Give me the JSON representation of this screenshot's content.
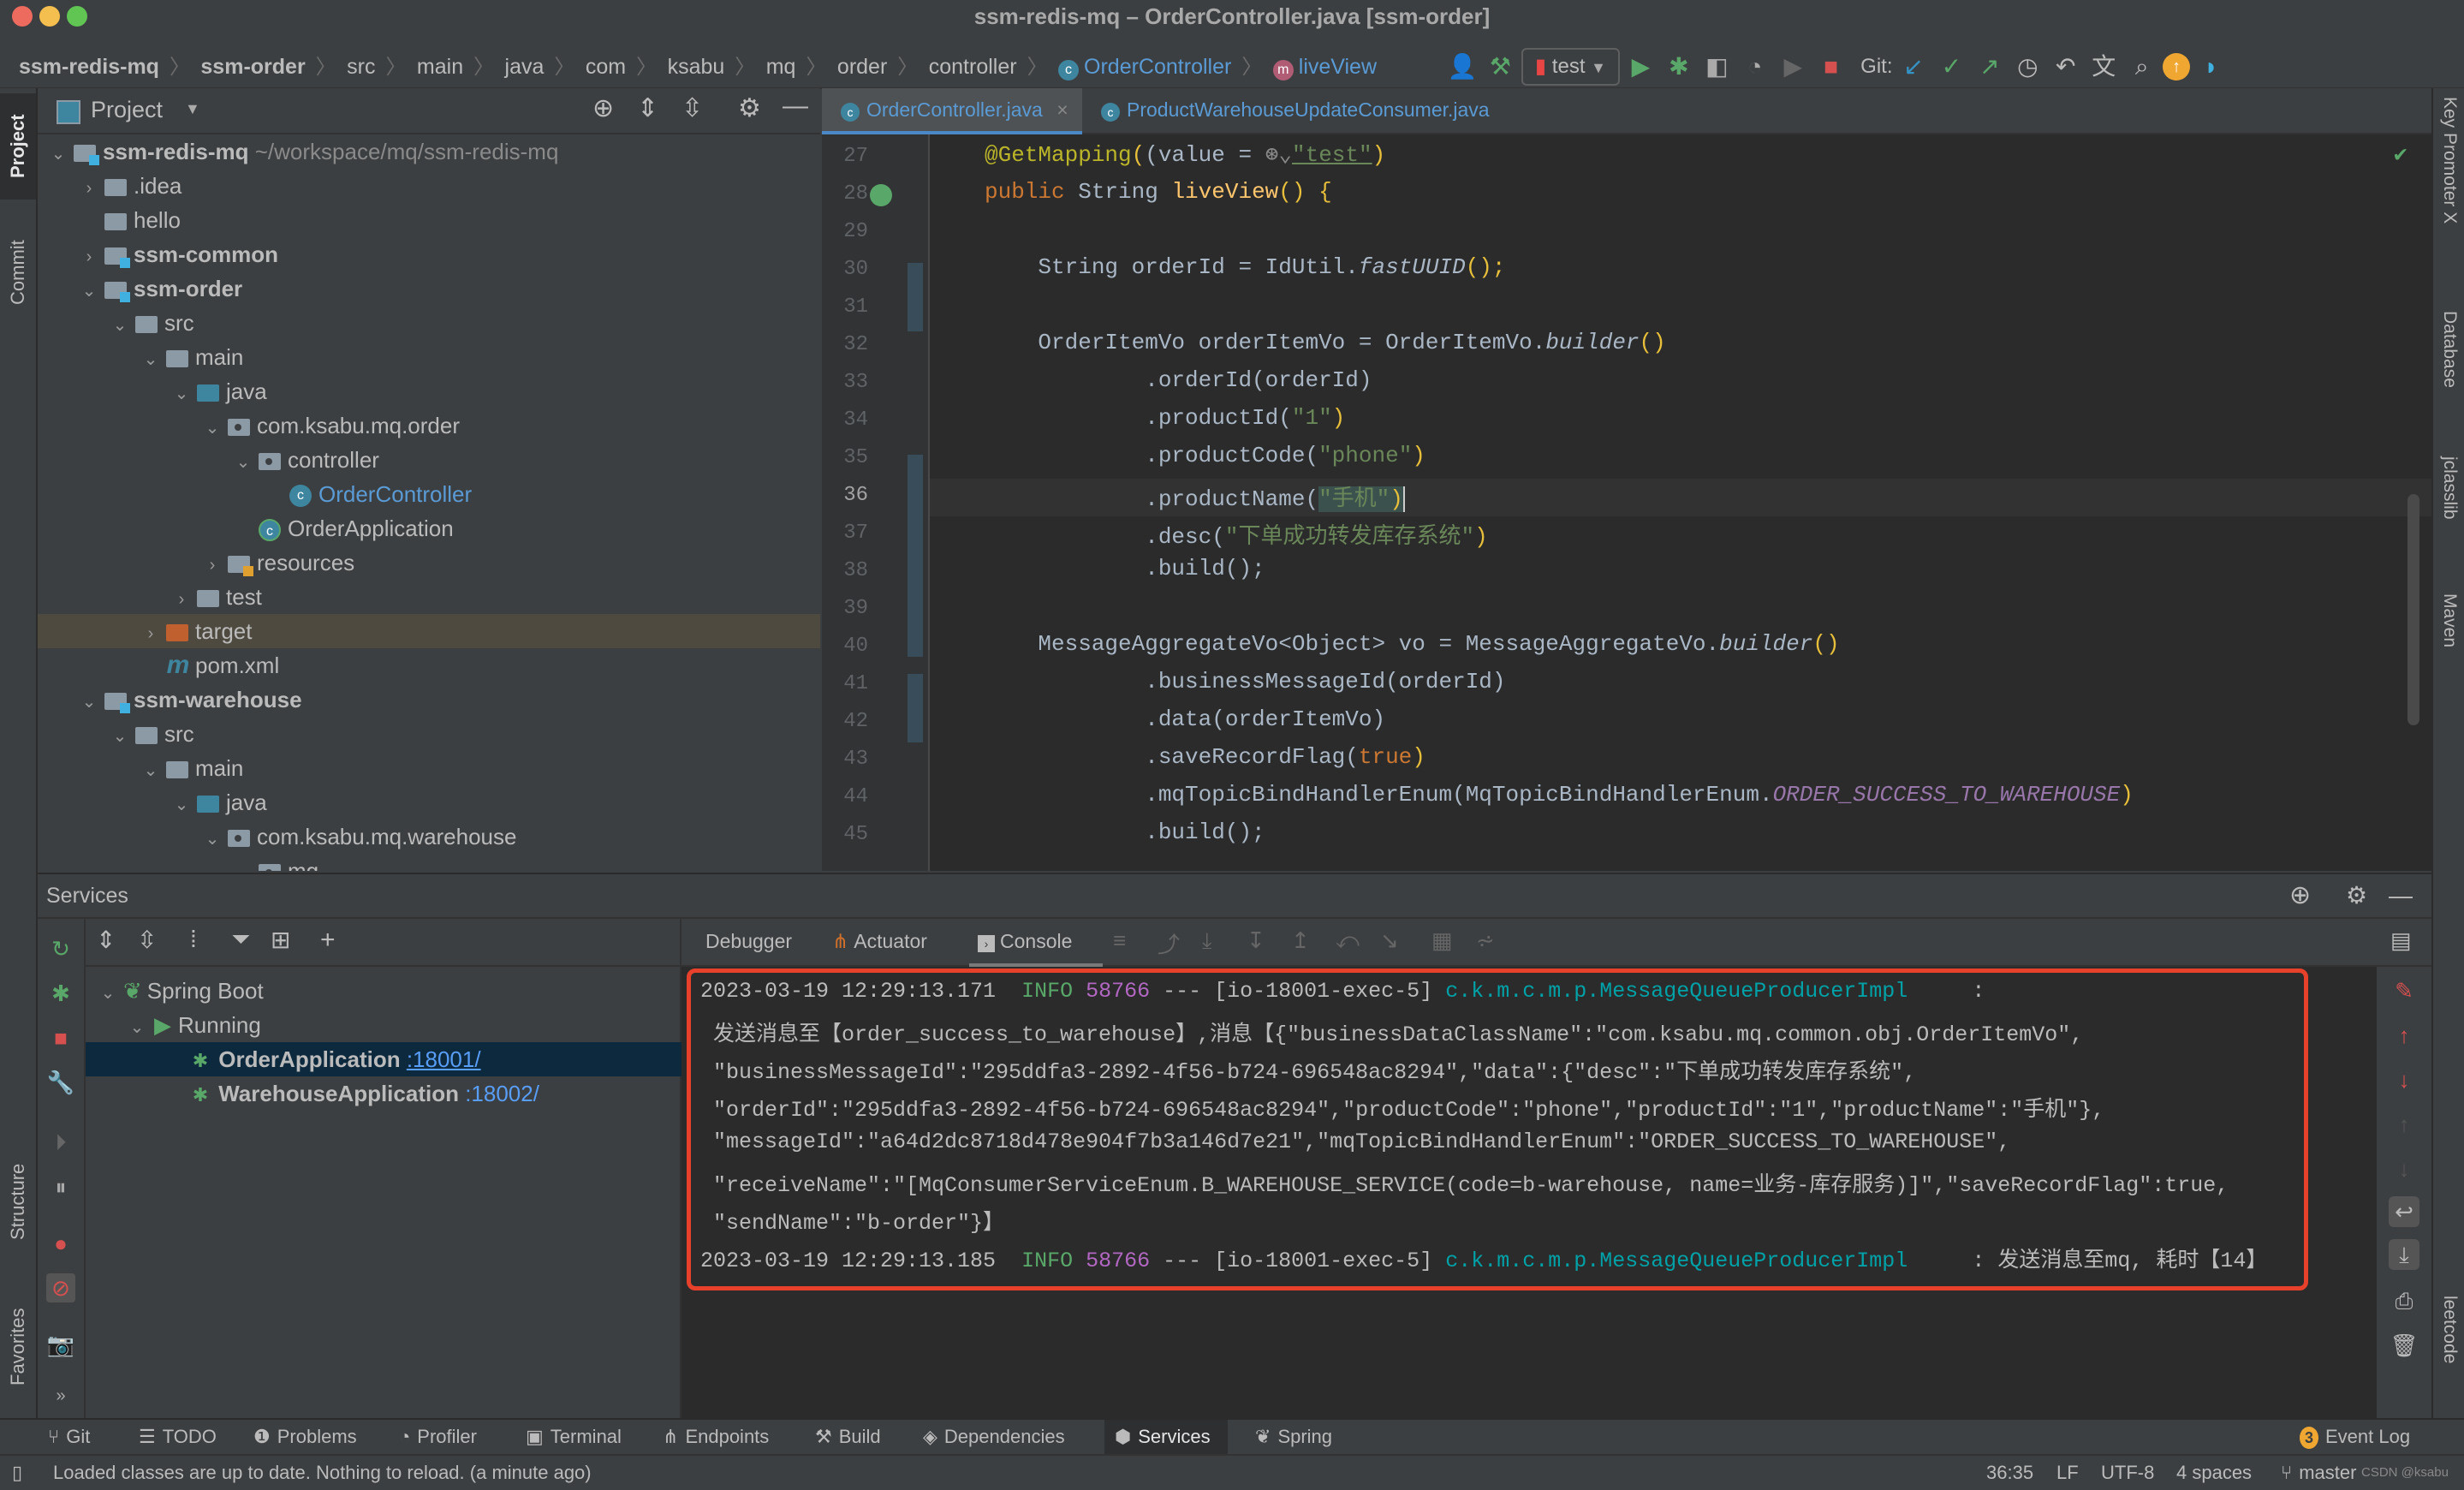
{
  "window": {
    "title": "ssm-redis-mq – OrderController.java [ssm-order]"
  },
  "breadcrumb": [
    "ssm-redis-mq",
    "ssm-order",
    "src",
    "main",
    "java",
    "com",
    "ksabu",
    "mq",
    "order",
    "controller",
    "OrderController",
    "liveView"
  ],
  "toolbar": {
    "run_config": "test",
    "git_label": "Git:"
  },
  "left_strip": {
    "project": "Project",
    "commit": "Commit",
    "structure": "Structure",
    "favorites": "Favorites"
  },
  "right_strip": {
    "key_promoter": "Key Promoter X",
    "database": "Database",
    "jclasslib": "jclasslib",
    "maven": "Maven",
    "leetcode": "leetcode"
  },
  "project": {
    "title": "Project",
    "tree": [
      {
        "label": "ssm-redis-mq",
        "extra": "~/workspace/mq/ssm-redis-mq",
        "bold": true
      },
      {
        "label": ".idea"
      },
      {
        "label": "hello"
      },
      {
        "label": "ssm-common",
        "bold": true
      },
      {
        "label": "ssm-order",
        "bold": true
      },
      {
        "label": "src"
      },
      {
        "label": "main"
      },
      {
        "label": "java"
      },
      {
        "label": "com.ksabu.mq.order"
      },
      {
        "label": "controller"
      },
      {
        "label": "OrderController"
      },
      {
        "label": "OrderApplication"
      },
      {
        "label": "resources"
      },
      {
        "label": "test"
      },
      {
        "label": "target"
      },
      {
        "label": "pom.xml"
      },
      {
        "label": "ssm-warehouse",
        "bold": true
      },
      {
        "label": "src"
      },
      {
        "label": "main"
      },
      {
        "label": "java"
      },
      {
        "label": "com.ksabu.mq.warehouse"
      },
      {
        "label": "mq"
      }
    ]
  },
  "editor": {
    "tabs": [
      {
        "label": "OrderController.java",
        "active": true
      },
      {
        "label": "ProductWarehouseUpdateConsumer.java",
        "active": false
      }
    ],
    "line_numbers": [
      "27",
      "28",
      "29",
      "30",
      "31",
      "32",
      "33",
      "34",
      "35",
      "36",
      "37",
      "38",
      "39",
      "40",
      "41",
      "42",
      "43",
      "44",
      "45"
    ],
    "code": {
      "l27_anno": "@GetMapping",
      "l27_rest": "(value = ",
      "l27_str": "\"test\"",
      "l28_kw": "public",
      "l28_type": " String ",
      "l28_fn": "liveView",
      "l28_rest": "() {",
      "l30_a": "    String orderId = IdUtil.",
      "l30_it": "fastUUID",
      "l30_b": "();",
      "l32_a": "    OrderItemVo orderItemVo = OrderItemVo.",
      "l32_it": "builder",
      "l32_b": "()",
      "l33": "            .orderId(orderId)",
      "l34_a": "            .productId(",
      "l34_s": "\"1\"",
      "l34_b": ")",
      "l35_a": "            .productCode(",
      "l35_s": "\"phone\"",
      "l35_b": ")",
      "l36_a": "            .productName(",
      "l36_s": "\"手机\"",
      "l36_b": ")",
      "l37_a": "            .desc(",
      "l37_s": "\"下单成功转发库存系统\"",
      "l37_b": ")",
      "l38": "            .build();",
      "l40_a": "    MessageAggregateVo<Object> vo = MessageAggregateVo.",
      "l40_it": "builder",
      "l40_b": "()",
      "l41": "            .businessMessageId(orderId)",
      "l42": "            .data(orderItemVo)",
      "l43_a": "            .saveRecordFlag(",
      "l43_kw": "true",
      "l43_b": ")",
      "l44_a": "            .mqTopicBindHandlerEnum(MqTopicBindHandlerEnum.",
      "l44_p": "ORDER_SUCCESS_TO_WAREHOUSE",
      "l44_b": ")",
      "l45": "            .build();"
    }
  },
  "services": {
    "title": "Services",
    "tree": {
      "root": "Spring Boot",
      "group": "Running",
      "apps": [
        {
          "name": "OrderApplication",
          "port": ":18001/",
          "selected": true
        },
        {
          "name": "WarehouseApplication",
          "port": ":18002/",
          "selected": false
        }
      ]
    },
    "tabs": [
      {
        "label": "Debugger"
      },
      {
        "label": "Actuator"
      },
      {
        "label": "Console",
        "active": true
      }
    ],
    "console": {
      "line1": {
        "ts": "2023-03-19 12:29:13.171",
        "level": "INFO",
        "pid": "58766",
        "thread": "--- [io-18001-exec-5]",
        "logger": "c.k.m.c.m.p.MessageQueueProducerImpl",
        "msg": "     :"
      },
      "wrapped": [
        " 发送消息至【order_success_to_warehouse】,消息【{\"businessDataClassName\":\"com.ksabu.mq.common.obj.OrderItemVo\",",
        " \"businessMessageId\":\"295ddfa3-2892-4f56-b724-696548ac8294\",\"data\":{\"desc\":\"下单成功转发库存系统\",",
        " \"orderId\":\"295ddfa3-2892-4f56-b724-696548ac8294\",\"productCode\":\"phone\",\"productId\":\"1\",\"productName\":\"手机\"},",
        " \"messageId\":\"a64d2dc8718d478e904f7b3a146d7e21\",\"mqTopicBindHandlerEnum\":\"ORDER_SUCCESS_TO_WAREHOUSE\",",
        " \"receiveName\":\"[MqConsumerServiceEnum.B_WAREHOUSE_SERVICE(code=b-warehouse, name=业务-库存服务)]\",\"saveRecordFlag\":true,",
        " \"sendName\":\"b-order\"}】"
      ],
      "line2": {
        "ts": "2023-03-19 12:29:13.185",
        "level": "INFO",
        "pid": "58766",
        "thread": "--- [io-18001-exec-5]",
        "logger": "c.k.m.c.m.p.MessageQueueProducerImpl",
        "msg": "     : 发送消息至mq, 耗时【14】"
      }
    }
  },
  "bottom_tools": [
    {
      "label": "Git"
    },
    {
      "label": "TODO"
    },
    {
      "label": "Problems"
    },
    {
      "label": "Profiler"
    },
    {
      "label": "Terminal"
    },
    {
      "label": "Endpoints"
    },
    {
      "label": "Build"
    },
    {
      "label": "Dependencies"
    },
    {
      "label": "Services",
      "active": true
    },
    {
      "label": "Spring"
    }
  ],
  "event_log": {
    "label": "Event Log",
    "count": "3"
  },
  "status": {
    "message": "Loaded classes are up to date. Nothing to reload. (a minute ago)",
    "position": "36:35",
    "line_sep": "LF",
    "encoding": "UTF-8",
    "indent": "4 spaces",
    "branch": "master",
    "watermark": "CSDN @ksabu"
  },
  "colors": {
    "accent": "#4a88c7",
    "highlight_border": "#e8412b",
    "info_green": "#59a869",
    "pid_purple": "#b267c3",
    "logger_teal": "#00a2a8"
  }
}
